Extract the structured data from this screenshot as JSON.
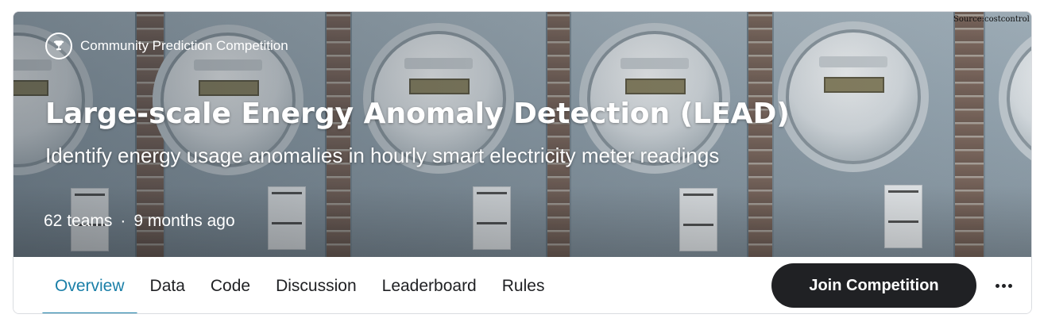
{
  "banner": {
    "source_credit": "Source:costcontrol",
    "badge_icon": "trophy-icon",
    "badge_label": "Community Prediction Competition",
    "title": "Large-scale Energy Anomaly Detection (LEAD)",
    "subtitle": "Identify energy usage anomalies in hourly smart electricity meter readings",
    "teams": "62 teams",
    "separator": "·",
    "age": "9 months ago"
  },
  "tabs": [
    {
      "label": "Overview",
      "active": true
    },
    {
      "label": "Data",
      "active": false
    },
    {
      "label": "Code",
      "active": false
    },
    {
      "label": "Discussion",
      "active": false
    },
    {
      "label": "Leaderboard",
      "active": false
    },
    {
      "label": "Rules",
      "active": false
    }
  ],
  "actions": {
    "join_label": "Join Competition",
    "more_icon": "more-horizontal-icon"
  },
  "colors": {
    "accent": "#1a7fa8",
    "button_bg": "#202124",
    "text": "#202124"
  }
}
